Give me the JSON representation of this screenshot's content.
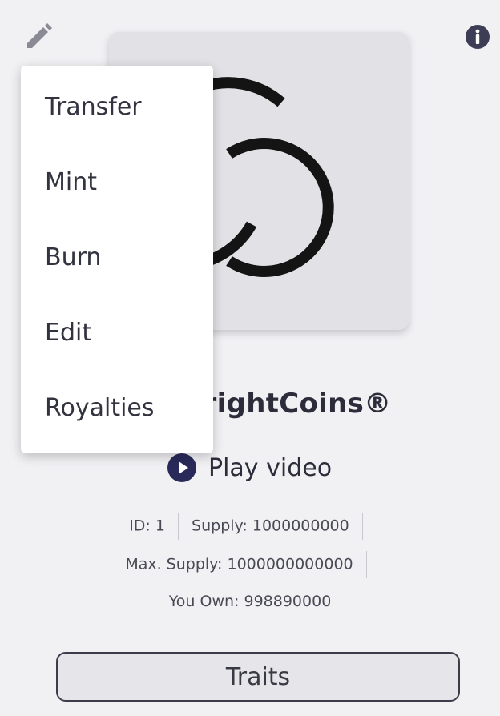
{
  "token": {
    "name": "rightCoins®",
    "play_label": "Play video",
    "id_text": "ID: 1",
    "supply_text": "Supply: 1000000000",
    "max_supply_text": "Max. Supply: 1000000000000",
    "you_own_text": "You Own: 998890000"
  },
  "menu": {
    "items": [
      {
        "label": "Transfer"
      },
      {
        "label": "Mint"
      },
      {
        "label": "Burn"
      },
      {
        "label": "Edit"
      },
      {
        "label": "Royalties"
      }
    ]
  },
  "buttons": {
    "traits_label": "Traits"
  },
  "icons": {
    "edit": "pencil-icon",
    "info": "info-icon",
    "play": "play-circle-icon"
  },
  "colors": {
    "background": "#f1f1f4",
    "accent": "#2a2a5a",
    "icon_gray": "#8a8a94",
    "image_bg": "#e2e2e6"
  }
}
